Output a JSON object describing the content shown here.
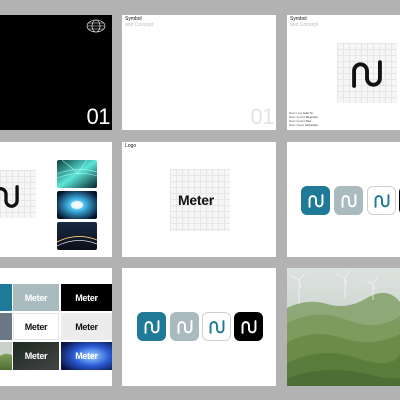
{
  "colors": {
    "background": "#b2b2b2",
    "brand_teal": "#1e7a96",
    "sage": "#a9bbbe",
    "black": "#000000",
    "white": "#ffffff"
  },
  "slide1": {
    "number": "01",
    "icon": "globe-wireframe-icon"
  },
  "slide2": {
    "title": "Symbol",
    "subtitle": "and Concept",
    "number": "01"
  },
  "slide3": {
    "title": "Symbol",
    "subtitle": "and Concept",
    "meta": [
      {
        "label": "Meter Logo",
        "value": "Letter M"
      },
      {
        "label": "Meter Symbol",
        "value": "Movement"
      },
      {
        "label": "Meter Symbol",
        "value": "Flow"
      },
      {
        "label": "Meter Values",
        "value": "Connection"
      }
    ]
  },
  "slide5": {
    "title": "Logo",
    "wordmark": "Meter"
  },
  "slide7": {
    "wordmarks": [
      "Meter",
      "Meter",
      "Meter",
      "Meter",
      "Meter",
      "Meter"
    ]
  }
}
